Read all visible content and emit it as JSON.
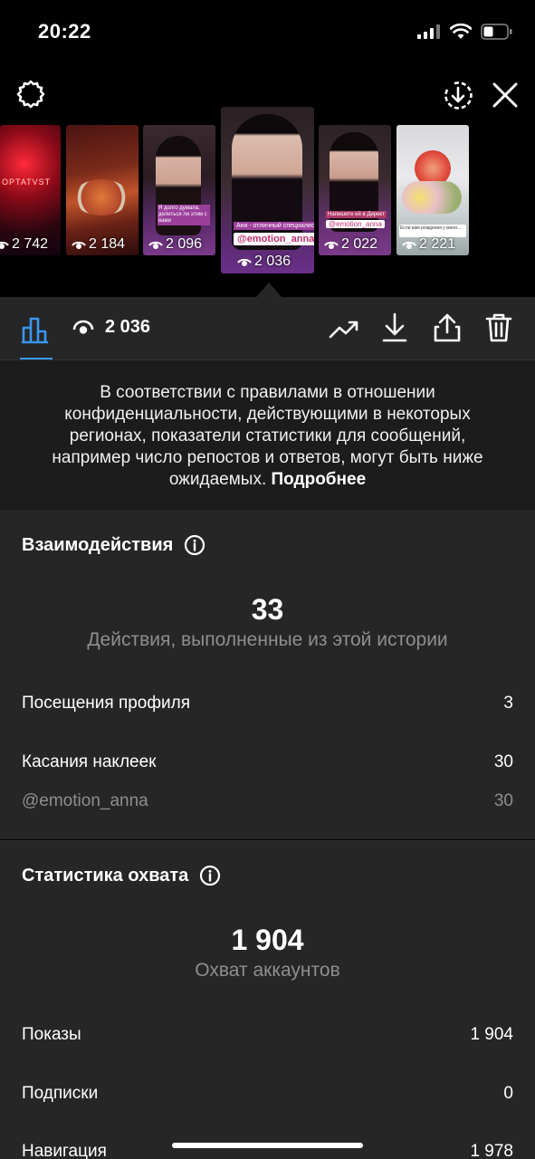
{
  "status_bar": {
    "time": "20:22"
  },
  "stories": [
    {
      "views": "2 742",
      "caption": "OPTATVST"
    },
    {
      "views": "2 184"
    },
    {
      "views": "2 096",
      "caption": "Я долго думала, делиться ли этим с вами"
    },
    {
      "views": "2 036",
      "caption": "Аня - отличный специалист!",
      "sticker": "@emotion_anna",
      "selected": true
    },
    {
      "views": "2 022",
      "caption": "Напишите ей в Директ",
      "sticker": "@emotion_anna"
    },
    {
      "views": "2 221",
      "caption": "Если вам рождения у меня..."
    }
  ],
  "toolbar": {
    "views": "2 036"
  },
  "notice": {
    "text": "В соответствии с правилами в отношении конфиденциальности, действующими в некоторых регионах, показатели статистики для сообщений, например число репостов и ответов, могут быть ниже ожидаемых.",
    "link": "Подробнее"
  },
  "interactions": {
    "title": "Взаимодействия",
    "total": "33",
    "caption": "Действия, выполненные из этой истории",
    "rows": [
      {
        "label": "Посещения профиля",
        "value": "3"
      },
      {
        "label": "Касания наклеек",
        "value": "30"
      },
      {
        "label": "@emotion_anna",
        "value": "30"
      }
    ]
  },
  "reach": {
    "title": "Статистика охвата",
    "total": "1 904",
    "caption": "Охват аккаунтов",
    "rows": [
      {
        "label": "Показы",
        "value": "1 904"
      },
      {
        "label": "Подписки",
        "value": "0"
      },
      {
        "label": "Навигация",
        "value": "1 978"
      }
    ]
  },
  "colors": {
    "accent": "#3897f0",
    "panel": "#262626",
    "notice_bg": "#1c1c1c",
    "muted": "#8e8e8e"
  }
}
